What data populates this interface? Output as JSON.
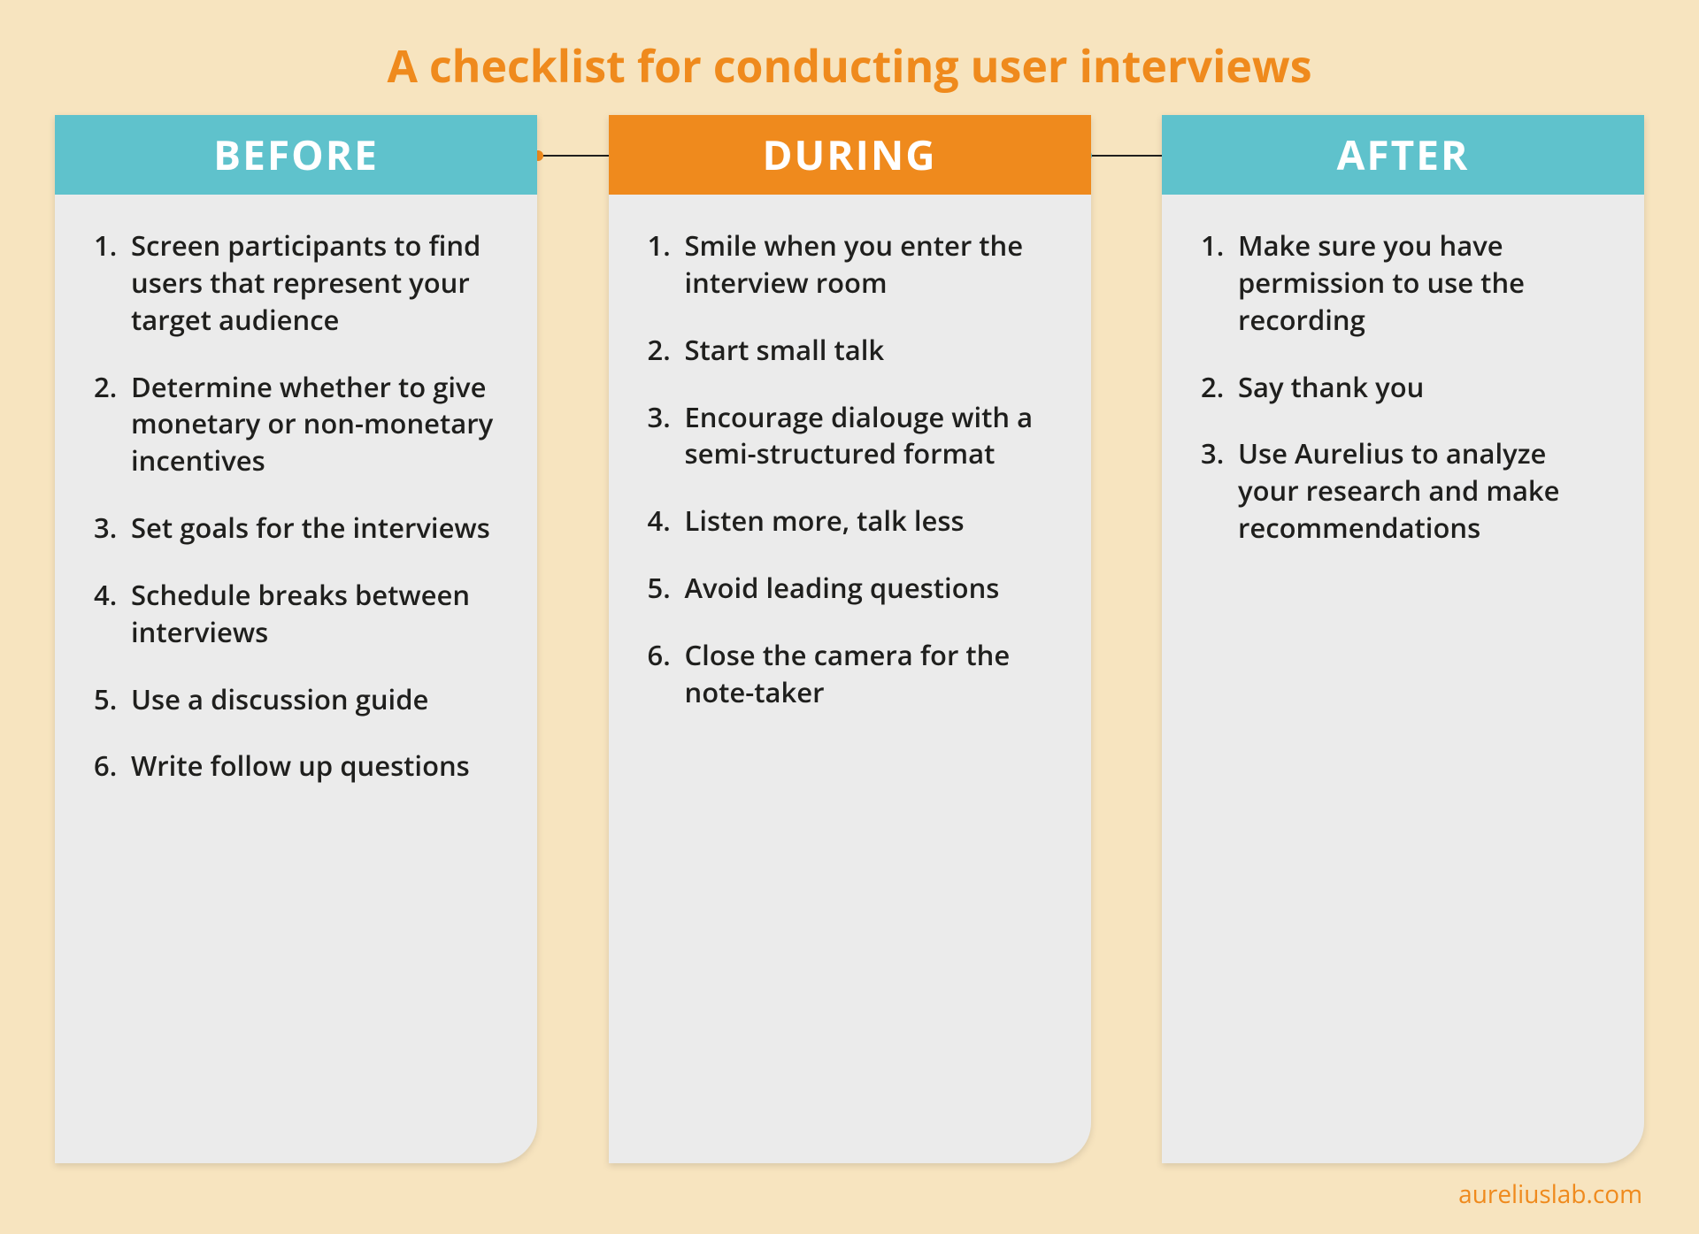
{
  "title": "A checklist for conducting user interviews",
  "footer": "aureliuslab.com",
  "colors": {
    "accent_orange": "#ef8a1d",
    "accent_teal": "#5fc2cc",
    "bg": "#f7e4bf",
    "card_bg": "#ebebeb"
  },
  "columns": [
    {
      "id": "before",
      "label": "BEFORE",
      "header_color": "teal",
      "items": [
        "Screen participants to find users that represent your target audience",
        "Determine whether to give monetary or non-monetary incentives",
        "Set goals for the interviews",
        "Schedule breaks between interviews",
        "Use a discussion guide",
        "Write follow up questions"
      ]
    },
    {
      "id": "during",
      "label": "DURING",
      "header_color": "orange",
      "items": [
        "Smile when you enter the interview room",
        "Start small talk",
        "Encourage dialouge with a semi-structured format",
        "Listen more, talk less",
        "Avoid leading questions",
        "Close the camera for the note-taker"
      ]
    },
    {
      "id": "after",
      "label": "AFTER",
      "header_color": "teal",
      "items": [
        "Make sure you have permission to use the recording",
        "Say thank you",
        "Use Aurelius to analyze your research and make recommendations"
      ]
    }
  ]
}
